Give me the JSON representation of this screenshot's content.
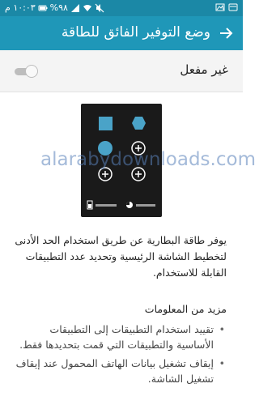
{
  "status_bar": {
    "time": "١٠:٠٣ م",
    "battery": "%٩٨",
    "icons": [
      "battery-icon",
      "signal-icon",
      "wifi-icon",
      "mute-icon",
      "image-notification-icon",
      "notification-icon"
    ]
  },
  "toolbar": {
    "title": "وضع التوفير الفائق للطاقة",
    "back_icon": "arrow-back-icon"
  },
  "toggle": {
    "label": "غير مفعل",
    "state": "off"
  },
  "illustration": {
    "icons": [
      "square-icon",
      "hexagon-icon",
      "circle-icon",
      "plus-icon",
      "plus-icon",
      "plus-icon"
    ]
  },
  "description": "يوفر طاقة البطارية عن طريق استخدام الحد الأدنى لتخطيط الشاشة الرئيسية وتحديد عدد التطبيقات القابلة للاستخدام.",
  "more_info": {
    "title": "مزيد من المعلومات",
    "items": [
      "تقييد استخدام التطبيقات إلى التطبيقات الأساسية والتطبيقات التي قمت بتحديدها فقط.",
      "إيقاف تشغيل بيانات الهاتف المحمول عند إيقاف تشغيل الشاشة."
    ]
  },
  "watermark": "alarabydownloads.com",
  "colors": {
    "status_bar": "#1b88a6",
    "toolbar": "#1f97b8",
    "accent_icons": "#4aa3c8"
  }
}
